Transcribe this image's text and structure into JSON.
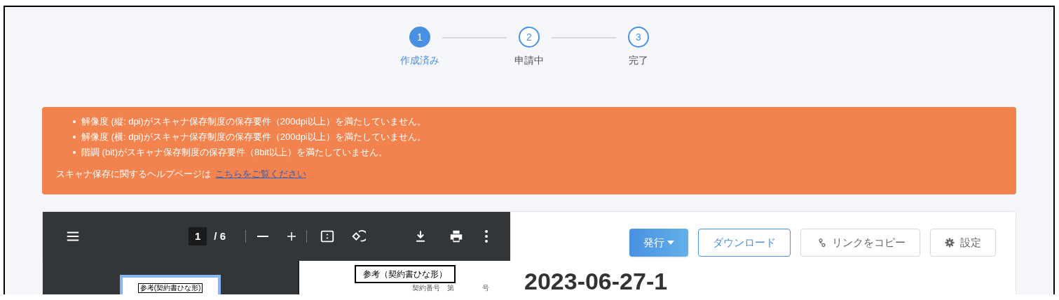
{
  "stepper": [
    {
      "number": "1",
      "label": "作成済み",
      "selected": true
    },
    {
      "number": "2",
      "label": "申請中",
      "selected": false
    },
    {
      "number": "3",
      "label": "完了",
      "selected": false
    }
  ],
  "alert": {
    "messages": [
      "解像度 (縦: dpi)がスキャナ保存制度の保存要件（200dpi以上）を満たしていません。",
      "解像度 (横: dpi)がスキャナ保存制度の保存要件（200dpi以上）を満たしていません。",
      "階調 (bit)がスキャナ保存制度の保存要件（8bit以上）を満たしていません。"
    ],
    "help_text": "スキャナ保存に関するヘルプページは",
    "help_link": "こちらをご覧ください"
  },
  "viewer": {
    "page_current": "1",
    "page_total": "/ 6",
    "thumbnail_heading": "参考(契約書ひな形)",
    "page_heading": "参考（契約書ひな形）",
    "page_line": "契約番号　第　　　　号"
  },
  "actions": [
    {
      "kind": "primary",
      "label": "発行"
    },
    {
      "kind": "outline",
      "label": "ダウンロード"
    },
    {
      "kind": "link",
      "label": "リンクをコピー"
    },
    {
      "kind": "settings",
      "label": "設定"
    }
  ],
  "title": "2023-06-27-1"
}
